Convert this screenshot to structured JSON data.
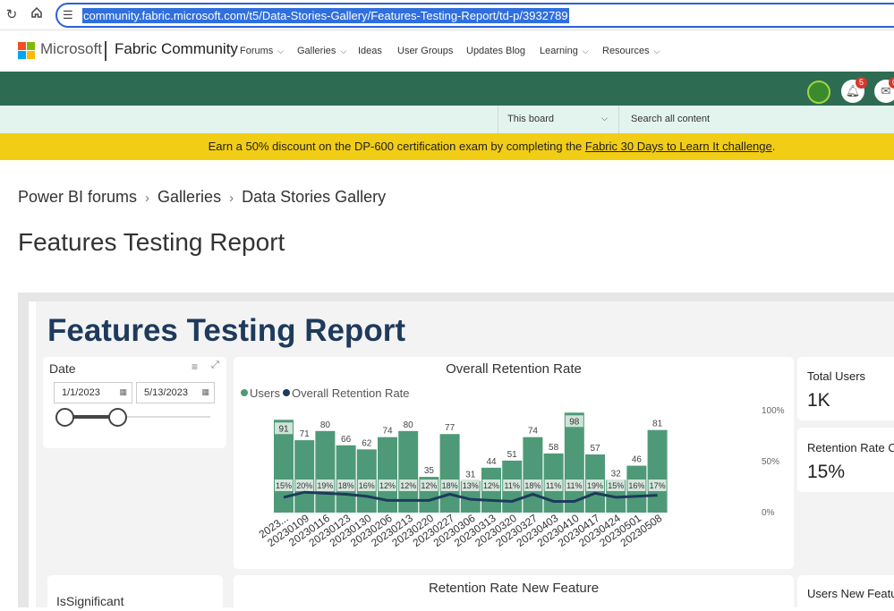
{
  "browser": {
    "url": "community.fabric.microsoft.com/t5/Data-Stories-Gallery/Features-Testing-Report/td-p/3932789",
    "icons": [
      "reload-icon",
      "home-icon",
      "tune-icon"
    ]
  },
  "header": {
    "logo_text": "Microsoft",
    "site_name": "Fabric Community",
    "nav": [
      {
        "label": "Forums",
        "dropdown": true
      },
      {
        "label": "Galleries",
        "dropdown": true
      },
      {
        "label": "Ideas",
        "dropdown": false
      },
      {
        "label": "User Groups",
        "dropdown": false
      },
      {
        "label": "Updates Blog",
        "dropdown": false
      },
      {
        "label": "Learning",
        "dropdown": true
      },
      {
        "label": "Resources",
        "dropdown": true
      }
    ],
    "notifications_count": "5",
    "messages_count": "0"
  },
  "search": {
    "scope": "This board",
    "placeholder": "Search all content"
  },
  "promo": {
    "text_before": "Earn a 50% discount on the DP-600 certification exam by completing the ",
    "link": "Fabric 30 Days to Learn It challenge",
    "text_after": "."
  },
  "breadcrumb": [
    "Power BI forums",
    "Galleries",
    "Data Stories Gallery"
  ],
  "page_title": "Features Testing Report",
  "report": {
    "title": "Features Testing Report",
    "date_slicer": {
      "label": "Date",
      "start": "1/1/2023",
      "end": "5/13/2023"
    },
    "kpis": [
      {
        "label": "Total Users",
        "value": "1K"
      },
      {
        "label": "Retention Rate O",
        "value": "15%"
      }
    ],
    "bottom_cards": {
      "slicer_label": "IsSignificant",
      "chart_title": "Retention Rate New Feature",
      "right_label": "Users New Featu"
    }
  },
  "colors": {
    "green_bar": "#2e6b53",
    "search_bg": "#e3f4ee",
    "promo": "#f1cd15",
    "report_title": "#1e3a5c",
    "users_bar": "#4e9a78",
    "retention_line": "#1e3a5c"
  },
  "chart_data": {
    "type": "bar",
    "title": "Overall Retention Rate",
    "legend": [
      "Users",
      "Overall Retention Rate"
    ],
    "legend_position": "top-left",
    "categories": [
      "2023...",
      "20230109",
      "20230116",
      "20230123",
      "20230130",
      "20230206",
      "20230213",
      "20230220",
      "20230227",
      "20230306",
      "20230313",
      "20230320",
      "20230327",
      "20230403",
      "20230410",
      "20230417",
      "20230424",
      "20230501",
      "20230508"
    ],
    "series": [
      {
        "name": "Users",
        "type": "bar",
        "values": [
          91,
          71,
          80,
          66,
          62,
          74,
          80,
          35,
          77,
          31,
          44,
          51,
          74,
          58,
          98,
          57,
          32,
          46,
          81
        ]
      },
      {
        "name": "Overall Retention Rate",
        "type": "line",
        "values": [
          15,
          20,
          19,
          18,
          16,
          12,
          12,
          12,
          18,
          13,
          12,
          11,
          18,
          11,
          11,
          19,
          15,
          16,
          17
        ],
        "labels": [
          "15%",
          "20%",
          "19%",
          "18%",
          "16%",
          "12%",
          "12%",
          "12%",
          "18%",
          "13%",
          "12%",
          "11%",
          "18%",
          "11%",
          "11%",
          "19%",
          "15%",
          "16%",
          "17%"
        ]
      }
    ],
    "y2_ticks": [
      "100%",
      "50%",
      "0%"
    ],
    "y2lim": [
      0,
      100
    ],
    "ylim": [
      0,
      100
    ]
  }
}
